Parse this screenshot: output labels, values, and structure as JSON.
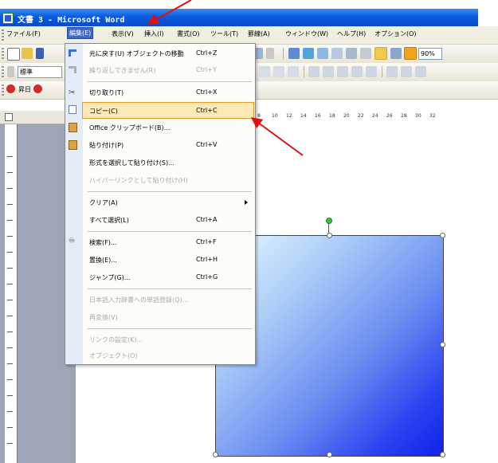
{
  "window": {
    "title": "文書 3 - Microsoft Word"
  },
  "menubar": {
    "items": [
      "ファイル(F)",
      "編集(E)",
      "表示(V)",
      "挿入(I)",
      "書式(O)",
      "ツール(T)",
      "罫線(A)",
      "ウィンドウ(W)",
      "ヘルプ(H)",
      "オプション(O)"
    ],
    "active_index": 1
  },
  "toolbar": {
    "zoom": "90%",
    "style": "標準",
    "start_label": "昇日"
  },
  "ruler": {
    "numbers": [
      "8",
      "10",
      "12",
      "14",
      "16",
      "18",
      "20",
      "22",
      "24",
      "26",
      "28",
      "30",
      "32"
    ]
  },
  "edit_menu": {
    "items": [
      {
        "label": "元に戻す(U) オブジェクトの移動",
        "shortcut": "Ctrl+Z",
        "disabled": false,
        "icon": "undo-icon"
      },
      {
        "label": "繰り返しできません(R)",
        "shortcut": "Ctrl+Y",
        "disabled": true,
        "icon": "redo-icon"
      },
      {
        "label": "切り取り(T)",
        "shortcut": "Ctrl+X",
        "disabled": false,
        "icon": "scissors-icon"
      },
      {
        "label": "コピー(C)",
        "shortcut": "Ctrl+C",
        "disabled": false,
        "icon": "copy-icon",
        "highlighted": true
      },
      {
        "label": "Office クリップボード(B)...",
        "shortcut": "",
        "disabled": false,
        "icon": "clipboard-icon"
      },
      {
        "label": "貼り付け(P)",
        "shortcut": "Ctrl+V",
        "disabled": false,
        "icon": "paste-icon"
      },
      {
        "label": "形式を選択して貼り付け(S)...",
        "shortcut": "",
        "disabled": false
      },
      {
        "label": "ハイパーリンクとして貼り付け(H)",
        "shortcut": "",
        "disabled": true
      },
      {
        "label": "クリア(A)",
        "shortcut": "",
        "disabled": false,
        "submenu": true
      },
      {
        "label": "すべて選択(L)",
        "shortcut": "Ctrl+A",
        "disabled": false
      },
      {
        "label": "検索(F)...",
        "shortcut": "Ctrl+F",
        "disabled": false,
        "icon": "binoculars-icon"
      },
      {
        "label": "置換(E)...",
        "shortcut": "Ctrl+H",
        "disabled": false
      },
      {
        "label": "ジャンプ(G)...",
        "shortcut": "Ctrl+G",
        "disabled": false
      },
      {
        "label": "日本語入力辞書への単語登録(Q)...",
        "shortcut": "",
        "disabled": true
      },
      {
        "label": "再変換(V)",
        "shortcut": "",
        "disabled": true
      },
      {
        "label": "リンクの設定(K)...",
        "shortcut": "",
        "disabled": true
      },
      {
        "label": "オブジェクト(O)",
        "shortcut": "",
        "disabled": true
      }
    ]
  },
  "colors": {
    "title_bar": "#0a5ce0",
    "menu_highlight": "#fde9b7",
    "annotation_arrow": "#e01010"
  }
}
